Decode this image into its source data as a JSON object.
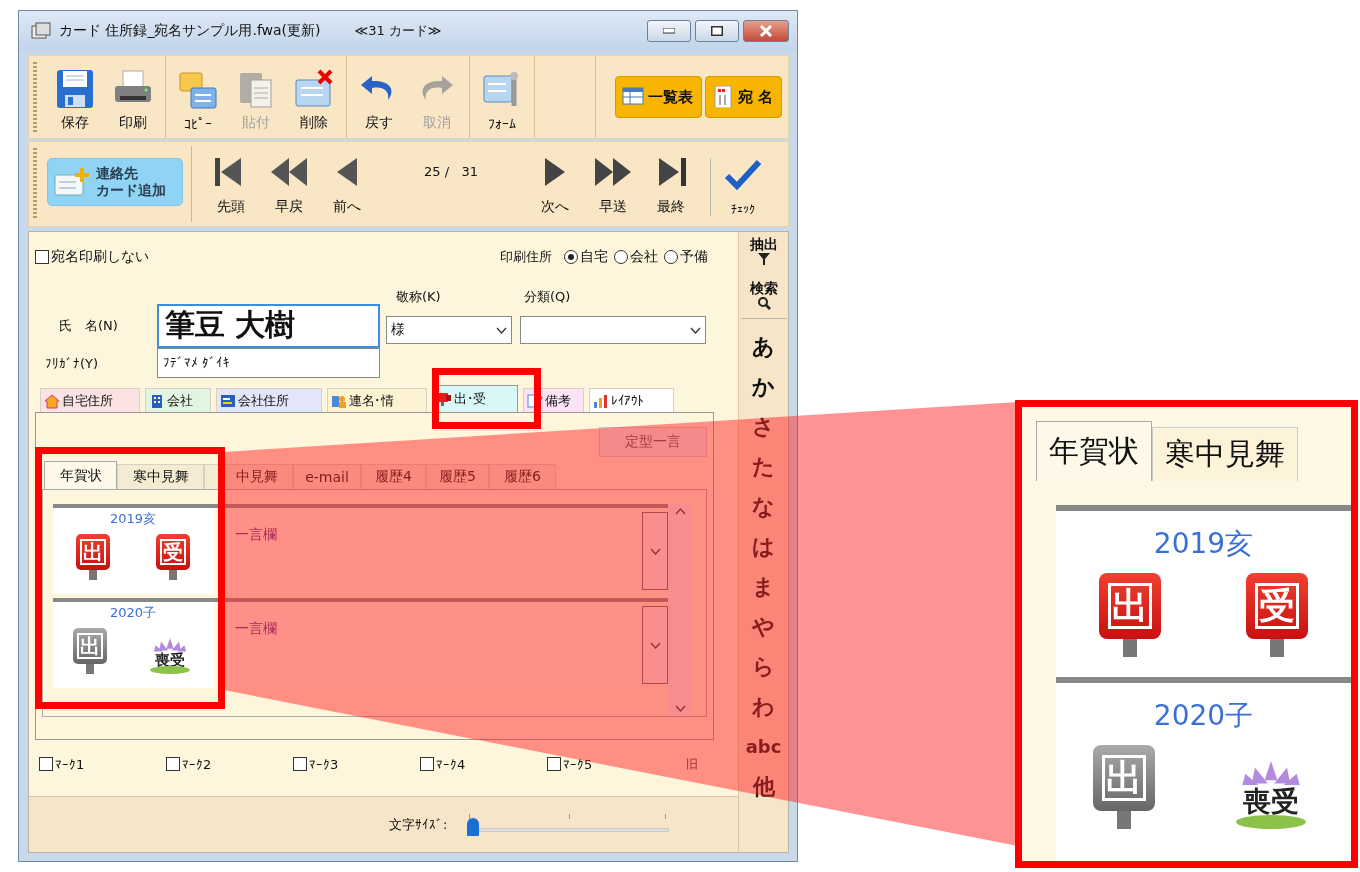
{
  "window": {
    "title": "カード 住所録_宛名サンプル用.fwa(更新)",
    "card_count": "≪31 カード≫"
  },
  "toolbar": {
    "groups": [
      [
        {
          "label": "保存",
          "disabled": false
        },
        {
          "label": "印刷",
          "disabled": false
        }
      ],
      [
        {
          "label": "ｺﾋﾟｰ",
          "disabled": false
        },
        {
          "label": "貼付",
          "disabled": true
        },
        {
          "label": "削除",
          "disabled": false
        }
      ],
      [
        {
          "label": "戻す",
          "disabled": false
        },
        {
          "label": "取消",
          "disabled": true
        }
      ],
      [
        {
          "label": "ﾌｫｰﾑ",
          "disabled": false
        }
      ]
    ],
    "views": [
      "一覧表",
      "宛 名"
    ]
  },
  "navigation": {
    "add_card": [
      "連絡先",
      "カード追加"
    ],
    "back": [
      "先頭",
      "早戻",
      "前へ"
    ],
    "position": "25 /   31",
    "forward": [
      "次へ",
      "早送",
      "最終"
    ],
    "check": "ﾁｪｯｸ"
  },
  "form": {
    "no_print": {
      "label": "宛名印刷しない",
      "checked": false
    },
    "print_address": {
      "label": "印刷住所",
      "options": [
        {
          "label": "自宅",
          "selected": true
        },
        {
          "label": "会社",
          "selected": false
        },
        {
          "label": "予備",
          "selected": false
        }
      ]
    },
    "name": {
      "label": "氏　名(N)",
      "value": "筆豆 大樹"
    },
    "honorific": {
      "label": "敬称(K)",
      "value": "様"
    },
    "category": {
      "label": "分類(Q)"
    },
    "furigana": {
      "label": "ﾌﾘｶﾞﾅ(Y)",
      "value": "ﾌﾃﾞﾏﾒ ﾀﾞｲｷ"
    }
  },
  "tabs": [
    {
      "label": "自宅住所",
      "selected": false,
      "color": "#fbe3e3"
    },
    {
      "label": "会社",
      "selected": false,
      "color": "#e2f4e2"
    },
    {
      "label": "会社住所",
      "selected": false,
      "color": "#e3e6f8"
    },
    {
      "label": "連名･情",
      "selected": false,
      "color": "#fdf2d2"
    },
    {
      "label": "出･受",
      "selected": true,
      "color": "#d9f7f7"
    },
    {
      "label": "備考",
      "selected": false,
      "color": "#fbe2f4"
    },
    {
      "label": "ﾚｲｱｳﾄ",
      "selected": false,
      "color": "#ffffff"
    }
  ],
  "phrase_button": {
    "label": "定型一言",
    "disabled": true
  },
  "sub_tabs": [
    {
      "label": "年賀状",
      "selected": true
    },
    {
      "label": "寒中見舞",
      "selected": false
    },
    {
      "label": "中見舞",
      "selected": false
    },
    {
      "label": "e-mail",
      "selected": false
    },
    {
      "label": "履歴4",
      "selected": false
    },
    {
      "label": "履歴5",
      "selected": false
    },
    {
      "label": "履歴6",
      "selected": false
    }
  ],
  "entries": [
    {
      "year": "2019亥",
      "sent": {
        "label": "出",
        "done": true
      },
      "received": {
        "kind": "normal",
        "label": "受"
      },
      "comment_placeholder": "一言欄"
    },
    {
      "year": "2020子",
      "sent": {
        "label": "出",
        "done": false
      },
      "received": {
        "kind": "mourning",
        "label": "喪受"
      },
      "comment_placeholder": "一言欄"
    }
  ],
  "marks": [
    {
      "label": "ﾏｰｸ1",
      "checked": false
    },
    {
      "label": "ﾏｰｸ2",
      "checked": false
    },
    {
      "label": "ﾏｰｸ3",
      "checked": false
    },
    {
      "label": "ﾏｰｸ4",
      "checked": false
    },
    {
      "label": "ﾏｰｸ5",
      "checked": false
    }
  ],
  "old_toggle": "旧",
  "font_size": {
    "label": "文字ｻｲｽﾞ:",
    "level": 0
  },
  "index_sidebar": {
    "filter": "抽出",
    "search": "検索",
    "kana": [
      "あ",
      "か",
      "さ",
      "た",
      "な",
      "は",
      "ま",
      "や",
      "ら",
      "わ",
      "abc",
      "他"
    ]
  },
  "callout": {
    "tabs": [
      {
        "label": "年賀状",
        "selected": true
      },
      {
        "label": "寒中見舞",
        "selected": false
      }
    ],
    "entries": [
      {
        "year": "2019亥",
        "sent": {
          "label": "出",
          "done": true
        },
        "received": {
          "kind": "normal",
          "label": "受"
        }
      },
      {
        "year": "2020子",
        "sent": {
          "label": "出",
          "done": false
        },
        "received": {
          "kind": "mourning",
          "label": "喪受"
        }
      }
    ]
  }
}
